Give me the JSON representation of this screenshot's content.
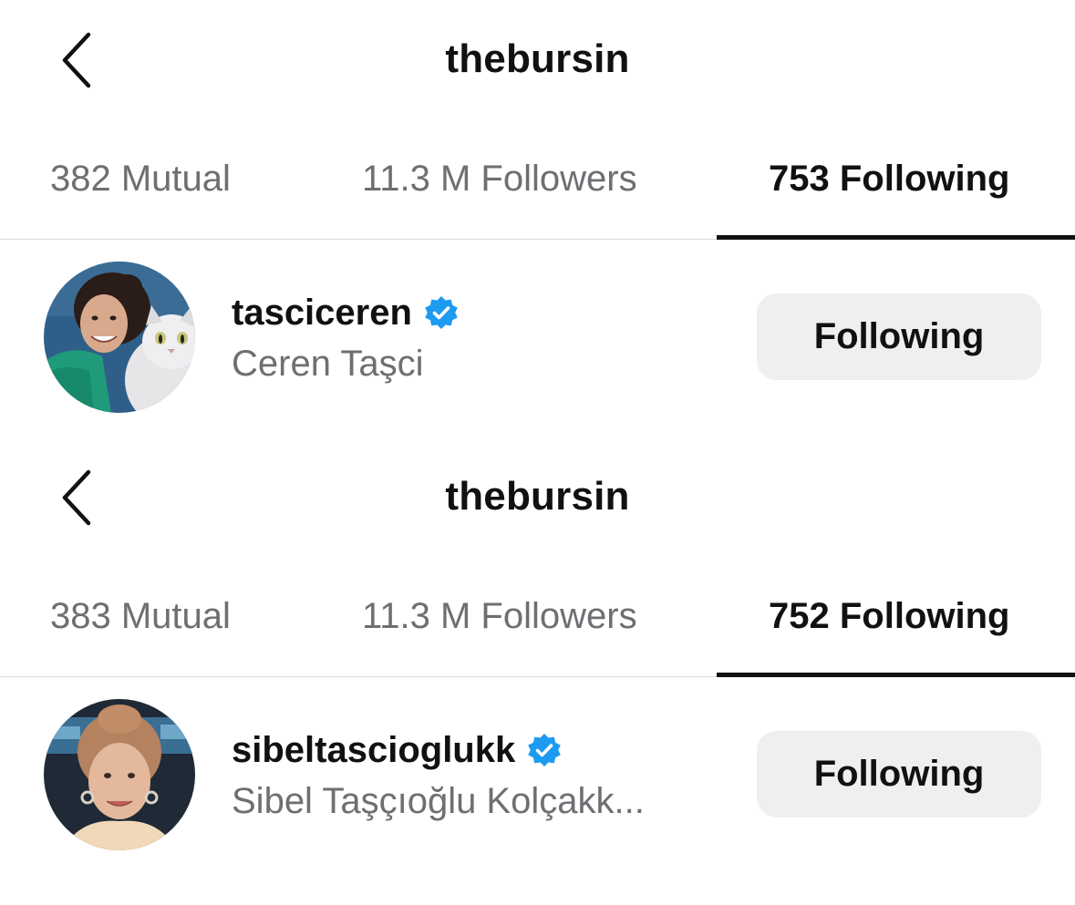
{
  "screens": [
    {
      "header": {
        "title": "thebursin",
        "back_icon": "chevron-left-icon"
      },
      "tabs": [
        {
          "label": "382 Mutual",
          "active": false
        },
        {
          "label": "11.3 M Followers",
          "active": false
        },
        {
          "label": "753 Following",
          "active": true
        }
      ],
      "user": {
        "username": "tasciceren",
        "full_name": "Ceren Taşci",
        "verified": true,
        "button_label": "Following"
      }
    },
    {
      "header": {
        "title": "thebursin",
        "back_icon": "chevron-left-icon"
      },
      "tabs": [
        {
          "label": "383 Mutual",
          "active": false
        },
        {
          "label": "11.3 M Followers",
          "active": false
        },
        {
          "label": "752 Following",
          "active": true
        }
      ],
      "user": {
        "username": "sibeltascioglukk",
        "full_name": "Sibel Taşçıoğlu Kolçakk...",
        "verified": true,
        "button_label": "Following"
      }
    }
  ],
  "colors": {
    "text_primary": "#111111",
    "text_secondary": "#6e6e73",
    "verified_blue": "#1d9bf0",
    "button_bg": "#efeff2",
    "divider": "#dbdbdb"
  }
}
